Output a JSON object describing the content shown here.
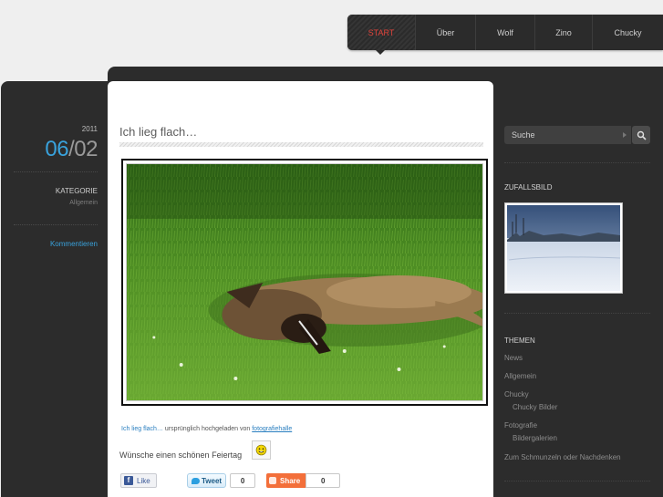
{
  "nav": {
    "items": [
      "START",
      "Über",
      "Wolf",
      "Zino",
      "Chucky"
    ],
    "active": "START",
    "active_color": "#e0433b"
  },
  "post": {
    "year": "2011",
    "day": "06",
    "month": "02",
    "category_heading": "KATEGORIE",
    "category": "Allgemein",
    "comment_link": "Kommentieren",
    "title": "Ich lieg flach…",
    "image_subject": "dog lying in grass",
    "caption_link": "Ich lieg flach…",
    "caption_middle": "ursprünglich hochgeladen von",
    "caption_author": "fotografiehalle",
    "text": "Wünsche einen schönen Feiertag",
    "emoticon": "smiley-icon"
  },
  "social": {
    "like_label": "Like",
    "tweet_label": "Tweet",
    "tweet_count": "0",
    "share_label": "Share",
    "share_count": "0"
  },
  "sidebar": {
    "search_placeholder": "Suche",
    "random_heading": "ZUFALLSBILD",
    "random_subject": "snowy landscape",
    "themes_heading": "THEMEN",
    "themes": [
      {
        "label": "News",
        "level": 0
      },
      {
        "label": "Allgemein",
        "level": 0
      },
      {
        "label": "Chucky",
        "level": 0
      },
      {
        "label": "Chucky Bilder",
        "level": 1
      },
      {
        "label": "Fotografie",
        "level": 0
      },
      {
        "label": "Bildergalerien",
        "level": 1
      },
      {
        "label": "Zum Schmunzeln oder Nachdenken",
        "level": 0
      }
    ]
  },
  "colors": {
    "accent_blue": "#39a2dc",
    "frame_dark": "#2c2c2c",
    "page_bg": "#efefef"
  }
}
